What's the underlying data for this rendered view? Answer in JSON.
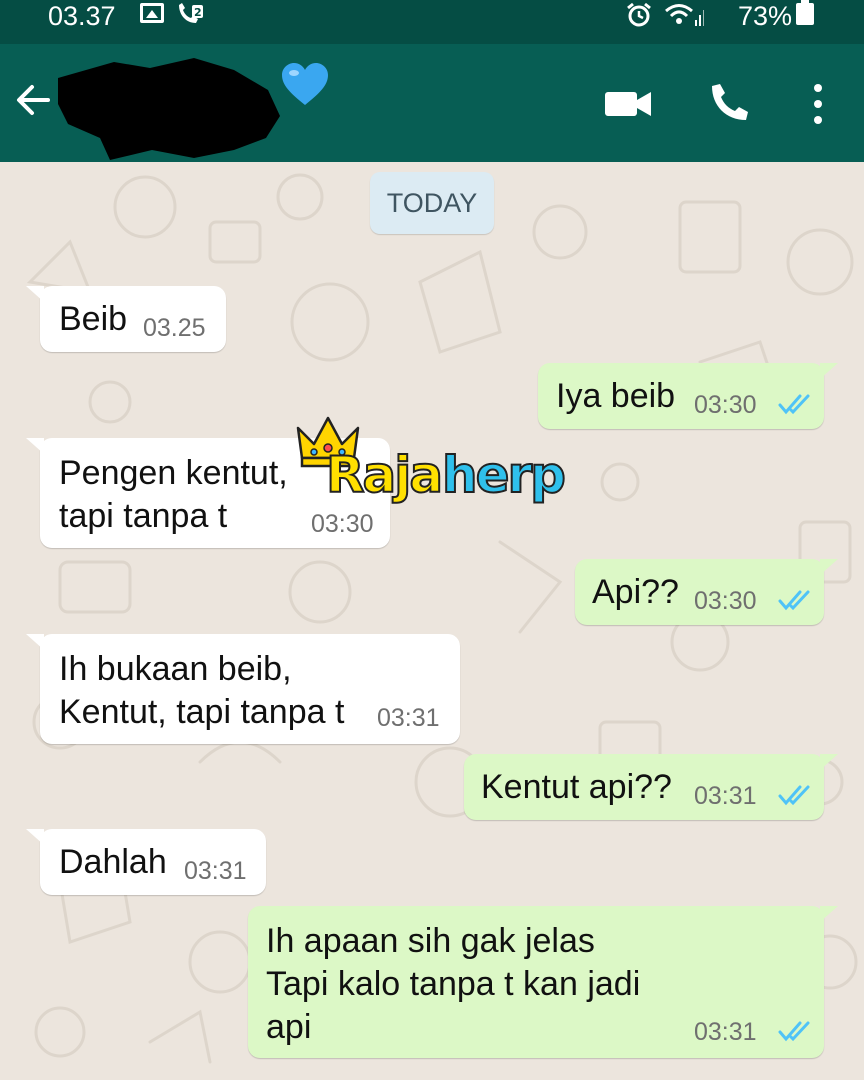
{
  "status_bar": {
    "time": "03.37",
    "battery": "73%",
    "icons": [
      "gallery-icon",
      "missed-call-icon",
      "alarm-icon",
      "wifi-icon",
      "signal-icon",
      "battery-charging-icon"
    ]
  },
  "header": {
    "contact_name": "",
    "heart_icon": "blue-heart-icon",
    "icons": [
      "back-arrow-icon",
      "video-call-icon",
      "voice-call-icon",
      "more-vert-icon"
    ]
  },
  "chat": {
    "date_label": "TODAY",
    "messages": [
      {
        "dir": "in",
        "text": "Beib",
        "time": "03.25"
      },
      {
        "dir": "out",
        "text": "Iya beib",
        "time": "03:30",
        "status": "read"
      },
      {
        "dir": "in",
        "text": "Pengen kentut,\ntapi tanpa t",
        "time": "03:30"
      },
      {
        "dir": "out",
        "text": "Api??",
        "time": "03:30",
        "status": "read"
      },
      {
        "dir": "in",
        "text": "Ih bukaan beib,\nKentut, tapi tanpa t",
        "time": "03:31"
      },
      {
        "dir": "out",
        "text": "Kentut api??",
        "time": "03:31",
        "status": "read"
      },
      {
        "dir": "in",
        "text": "Dahlah",
        "time": "03:31"
      },
      {
        "dir": "out",
        "text": "Ih apaan sih gak jelas\nTapi kalo tanpa t kan jadi\napi",
        "time": "03:31",
        "status": "read"
      }
    ]
  },
  "watermark": {
    "part1": "Raja",
    "part2": "herp"
  },
  "colors": {
    "status_bar": "#054d44",
    "header": "#075e54",
    "chat_bg": "#ece5dd",
    "outgoing": "#dcf8c6",
    "incoming": "#ffffff",
    "read_ticks": "#4fc3f7"
  }
}
